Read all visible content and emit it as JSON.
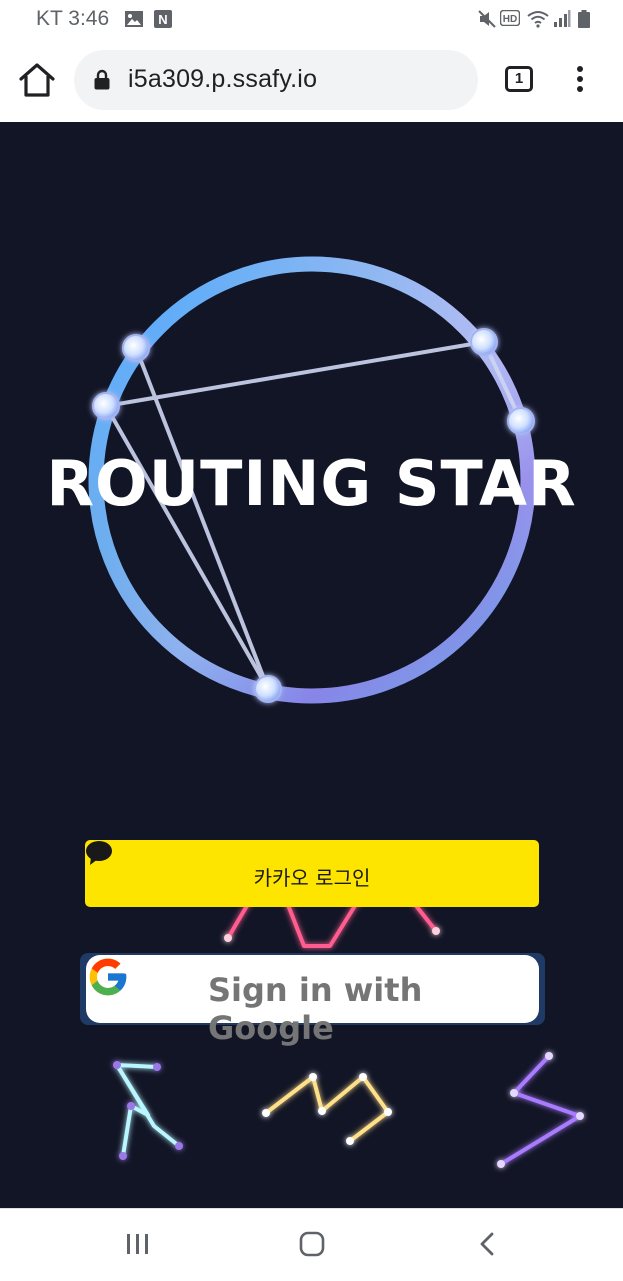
{
  "status_bar": {
    "time_text": "KT 3:46",
    "icons": [
      "gallery-icon",
      "naver-icon",
      "mute-icon",
      "hd-icon",
      "wifi-icon",
      "signal-icon",
      "battery-icon"
    ],
    "naver_letter": "N",
    "hd_label": "HD"
  },
  "browser": {
    "url": "i5a309.p.ssafy.io",
    "tab_count": "1"
  },
  "page": {
    "title": "ROUTING STAR",
    "kakao_label": "카카오 로그인",
    "google_label": "Sign in with Google",
    "colors": {
      "background": "#121526",
      "kakao": "#fee500",
      "pink_neon": "#ff5d8f",
      "cyan_neon": "#b9f6ff",
      "yellow_neon": "#ffe08a",
      "purple_neon": "#a97bff"
    }
  },
  "nav": {
    "icons": [
      "recent-apps-icon",
      "home-nav-icon",
      "back-icon"
    ]
  }
}
